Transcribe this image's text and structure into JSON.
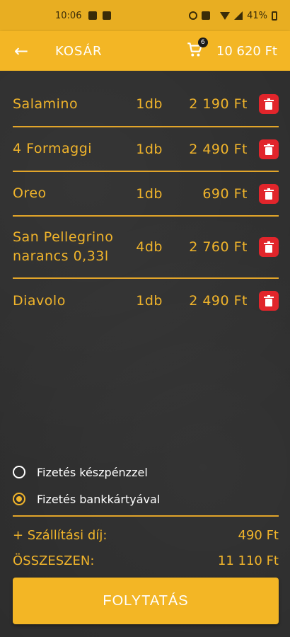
{
  "status_bar": {
    "time": "10:06",
    "battery": "41%"
  },
  "app_bar": {
    "back_icon": "arrow-left-icon",
    "title": "KOSÁR",
    "cart_badge": "6",
    "cart_total": "10 620 Ft"
  },
  "cart": {
    "items": [
      {
        "name": "Salamino",
        "qty": "1db",
        "price": "2 190 Ft"
      },
      {
        "name": "4 Formaggi",
        "qty": "1db",
        "price": "2 490 Ft"
      },
      {
        "name": "Oreo",
        "qty": "1db",
        "price": "690 Ft"
      },
      {
        "name": "San Pellegrino narancs 0,33l",
        "qty": "4db",
        "price": "2 760 Ft"
      },
      {
        "name": "Diavolo",
        "qty": "1db",
        "price": "2 490 Ft"
      }
    ]
  },
  "payment": {
    "cash_label": "Fizetés készpénzzel",
    "card_label": "Fizetés bankkártyával",
    "selected": "card"
  },
  "summary": {
    "delivery_label": "+ Szállítási díj:",
    "delivery_value": "490 Ft",
    "total_label": "ÖSSZESZEN:",
    "total_value": "11 110 Ft"
  },
  "cta": {
    "label": "FOLYTATÁS"
  },
  "colors": {
    "accent": "#f3b625",
    "text_accent": "#f0b42b",
    "delete": "#e1252b",
    "background": "#2d2d2d"
  }
}
